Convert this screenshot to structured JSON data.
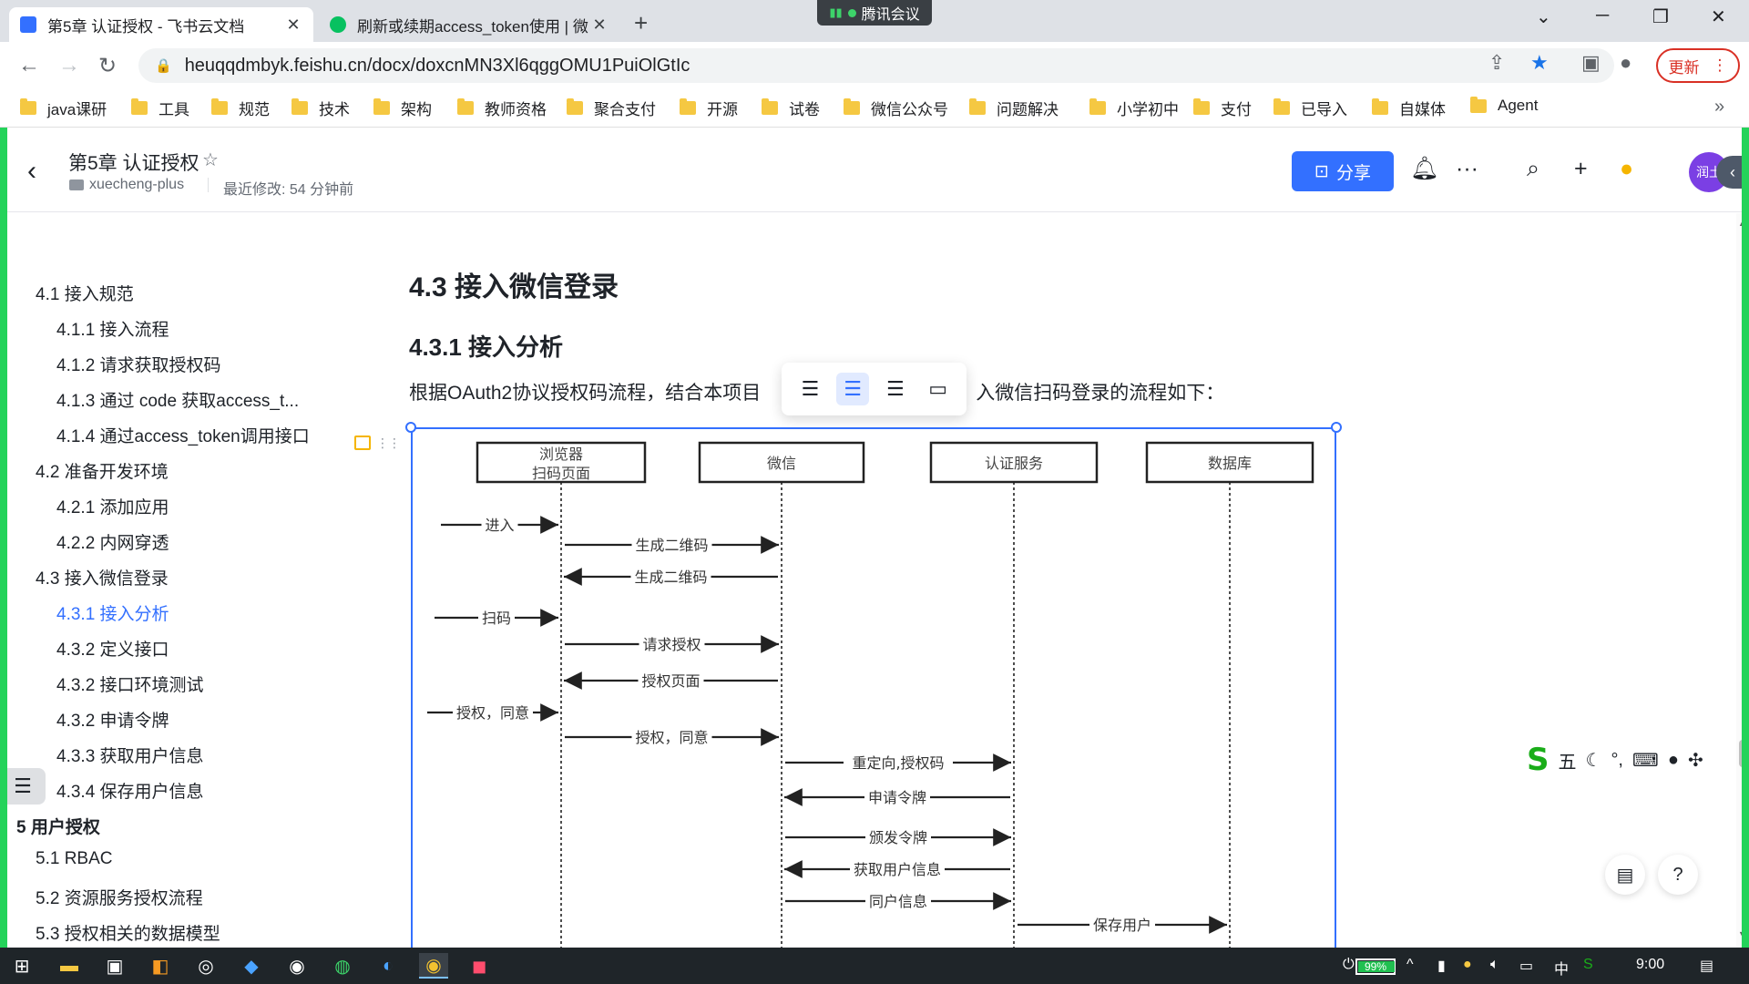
{
  "browser": {
    "tabs": [
      {
        "title": "第5章 认证授权 - 飞书云文档",
        "active": true,
        "icon": "feishu-doc-icon",
        "color": "#3370ff"
      },
      {
        "title": "刷新或续期access_token使用 | 微",
        "active": false,
        "icon": "wechat-icon",
        "color": "#07c160"
      }
    ],
    "meeting_label": "腾讯会议",
    "url": "heuqqdmbyk.feishu.cn/docx/doxcnMN3Xl6qggOMU1PuiOlGtIc",
    "update_label": "更新",
    "bookmarks": [
      "java课研",
      "工具",
      "规范",
      "技术",
      "架构",
      "教师资格",
      "聚合支付",
      "开源",
      "试卷",
      "微信公众号",
      "问题解决",
      "小学初中",
      "支付",
      "已导入",
      "自媒体",
      "Agent"
    ]
  },
  "doc_header": {
    "title": "第5章 认证授权",
    "folder": "xuecheng-plus",
    "modified": "最近修改: 54 分钟前",
    "share_label": "分享",
    "avatar_text": "润土"
  },
  "outline": [
    {
      "label": "4.1 接入规范",
      "level": 2
    },
    {
      "label": "4.1.1 接入流程",
      "level": 3
    },
    {
      "label": "4.1.2 请求获取授权码",
      "level": 3
    },
    {
      "label": "4.1.3 通过 code 获取access_t...",
      "level": 3
    },
    {
      "label": "4.1.4 通过access_token调用接口",
      "level": 3
    },
    {
      "label": "4.2 准备开发环境",
      "level": 2
    },
    {
      "label": "4.2.1 添加应用",
      "level": 3
    },
    {
      "label": "4.2.2 内网穿透",
      "level": 3
    },
    {
      "label": "4.3 接入微信登录",
      "level": 2
    },
    {
      "label": "4.3.1 接入分析",
      "level": 3,
      "active": true
    },
    {
      "label": "4.3.2 定义接口",
      "level": 3
    },
    {
      "label": "4.3.2 接口环境测试",
      "level": 3
    },
    {
      "label": "4.3.2 申请令牌",
      "level": 3
    },
    {
      "label": "4.3.3 获取用户信息",
      "level": 3
    },
    {
      "label": "4.3.4 保存用户信息",
      "level": 3
    },
    {
      "label": "5 用户授权",
      "level": 1
    },
    {
      "label": "5.1 RBAC",
      "level": 2
    },
    {
      "label": "5.2 资源服务授权流程",
      "level": 2
    },
    {
      "label": "5.3 授权相关的数据模型",
      "level": 2
    }
  ],
  "content": {
    "h2": "4.3 接入微信登录",
    "h3": "4.3.1 接入分析",
    "para_before": "根据OAuth2协议授权码流程，结合本项目",
    "para_after": "入微信扫码登录的流程如下："
  },
  "diagram": {
    "participants": [
      {
        "line1": "浏览器",
        "line2": "扫码页面"
      },
      {
        "line1": "微信"
      },
      {
        "line1": "认证服务"
      },
      {
        "line1": "数据库"
      }
    ],
    "messages": [
      {
        "from": "outside",
        "to": 0,
        "label": "进入"
      },
      {
        "from": 0,
        "to": 1,
        "label": "生成二维码"
      },
      {
        "from": 1,
        "to": 0,
        "label": "生成二维码"
      },
      {
        "from": "outside",
        "to": 0,
        "label": "扫码"
      },
      {
        "from": 0,
        "to": 1,
        "label": "请求授权"
      },
      {
        "from": 1,
        "to": 0,
        "label": "授权页面"
      },
      {
        "from": "outside",
        "to": 0,
        "label": "授权，同意"
      },
      {
        "from": 0,
        "to": 1,
        "label": "授权，同意"
      },
      {
        "from": 1,
        "to": 2,
        "label": "重定向,授权码"
      },
      {
        "from": 2,
        "to": 1,
        "label": "申请令牌"
      },
      {
        "from": 1,
        "to": 2,
        "label": "颁发令牌"
      },
      {
        "from": 2,
        "to": 1,
        "label": "获取用户信息"
      },
      {
        "from": 1,
        "to": 2,
        "label": "同户信息"
      },
      {
        "from": 2,
        "to": 3,
        "label": "保存用户"
      }
    ]
  },
  "ime_label": "五",
  "taskbar": {
    "battery": "99%",
    "ime": "中",
    "time": "9:00"
  }
}
